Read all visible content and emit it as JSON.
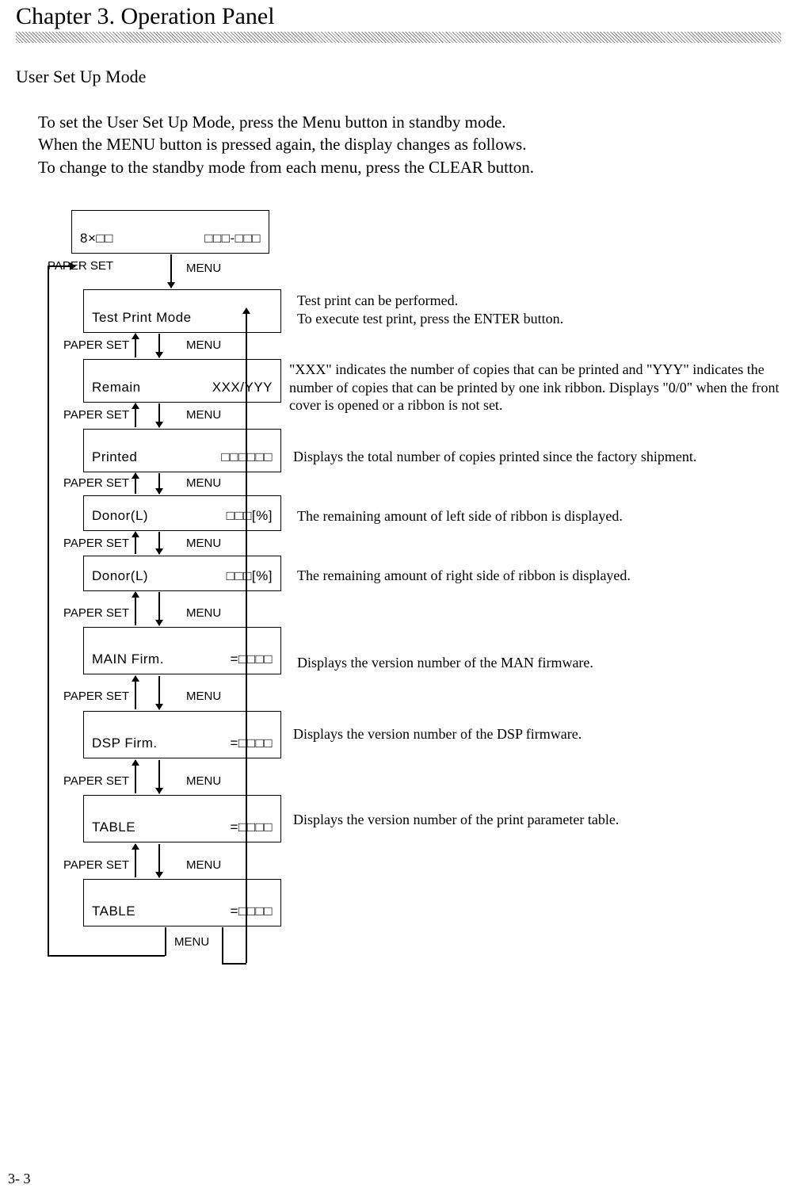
{
  "chapter_title": "Chapter 3. Operation Panel",
  "section_title": "User Set Up Mode",
  "intro_lines": [
    "To set the User Set Up Mode, press the Menu button in standby mode.",
    "When the MENU button is pressed again, the display changes as follows.",
    "To change to the standby mode from each menu, press the CLEAR button."
  ],
  "labels": {
    "paper_set": "PAPER SET",
    "menu": "MENU"
  },
  "boxes": [
    {
      "left": "8×□□",
      "right": "□□□-□□□"
    },
    {
      "left": "Test Print Mode",
      "right": ""
    },
    {
      "left": "Remain",
      "right": "XXX/YYY"
    },
    {
      "left": "Printed",
      "right": "□□□□□□"
    },
    {
      "left": "Donor(L)",
      "right": "□□□[%]"
    },
    {
      "left": "Donor(L)",
      "right": "□□□[%]"
    },
    {
      "left": "MAIN Firm.",
      "right": "=□□□□"
    },
    {
      "left": "DSP Firm.",
      "right": "=□□□□"
    },
    {
      "left": "TABLE",
      "right": "=□□□□"
    },
    {
      "left": "TABLE",
      "right": "=□□□□"
    }
  ],
  "descriptions": {
    "test_print": "Test print can be performed.\nTo execute test print, press the ENTER button.",
    "remain": "\"XXX\" indicates the number of copies that can be printed and \"YYY\" indicates the number of copies that can be printed by one ink ribbon. Displays \"0/0\" when the front cover is opened or a ribbon is not set.",
    "printed": "Displays the total number of copies printed since the factory shipment.",
    "donor_l": "The remaining amount of left side of ribbon is displayed.",
    "donor_r": "The remaining amount of right side of ribbon is displayed.",
    "main_firm": "Displays the version number of the MAN firmware.",
    "dsp_firm": "Displays the version number of the DSP firmware.",
    "table": "Displays the version number of the print parameter table."
  },
  "page_number": "3- 3"
}
